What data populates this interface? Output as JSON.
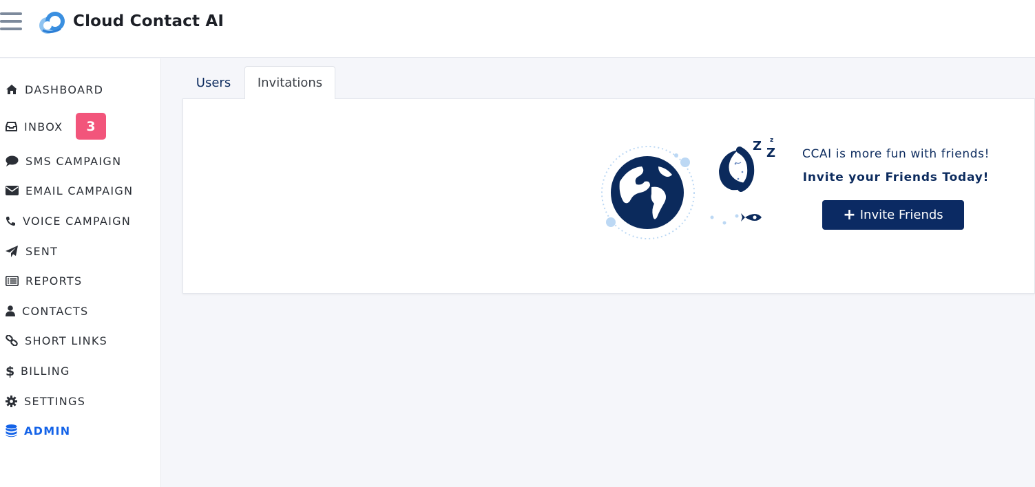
{
  "header": {
    "brand": "Cloud Contact AI",
    "menu_icon": "hamburger-menu-icon",
    "logo_icon": "cloud-logo-icon"
  },
  "sidebar": {
    "items": [
      {
        "label": "DASHBOARD",
        "icon": "home-icon"
      },
      {
        "label": "INBOX",
        "icon": "inbox-icon",
        "badge": "3"
      },
      {
        "label": "SMS CAMPAIGN",
        "icon": "chat-bubble-icon"
      },
      {
        "label": "EMAIL CAMPAIGN",
        "icon": "envelope-icon"
      },
      {
        "label": "VOICE CAMPAIGN",
        "icon": "phone-icon"
      },
      {
        "label": "SENT",
        "icon": "paper-plane-icon"
      },
      {
        "label": "REPORTS",
        "icon": "list-icon"
      },
      {
        "label": "CONTACTS",
        "icon": "user-icon"
      },
      {
        "label": "SHORT LINKS",
        "icon": "link-icon"
      },
      {
        "label": "BILLING",
        "icon": "dollar-icon"
      },
      {
        "label": "SETTINGS",
        "icon": "gear-icon"
      },
      {
        "label": "ADMIN",
        "icon": "database-icon",
        "active": true
      }
    ]
  },
  "tabs": [
    {
      "label": "Users",
      "active": false
    },
    {
      "label": "Invitations",
      "active": true
    }
  ],
  "invitations": {
    "message": "CCAI is more fun with friends!",
    "cta_text": "Invite your Friends Today!",
    "button_label": "Invite Friends",
    "button_icon": "plus-icon",
    "illustration": "sleeping-globe-moon-rocket-illustration"
  },
  "colors": {
    "brand_navy": "#0b2a63",
    "active_blue": "#1463e8",
    "badge_pink": "#f2557b",
    "background": "#f5f6fa"
  }
}
